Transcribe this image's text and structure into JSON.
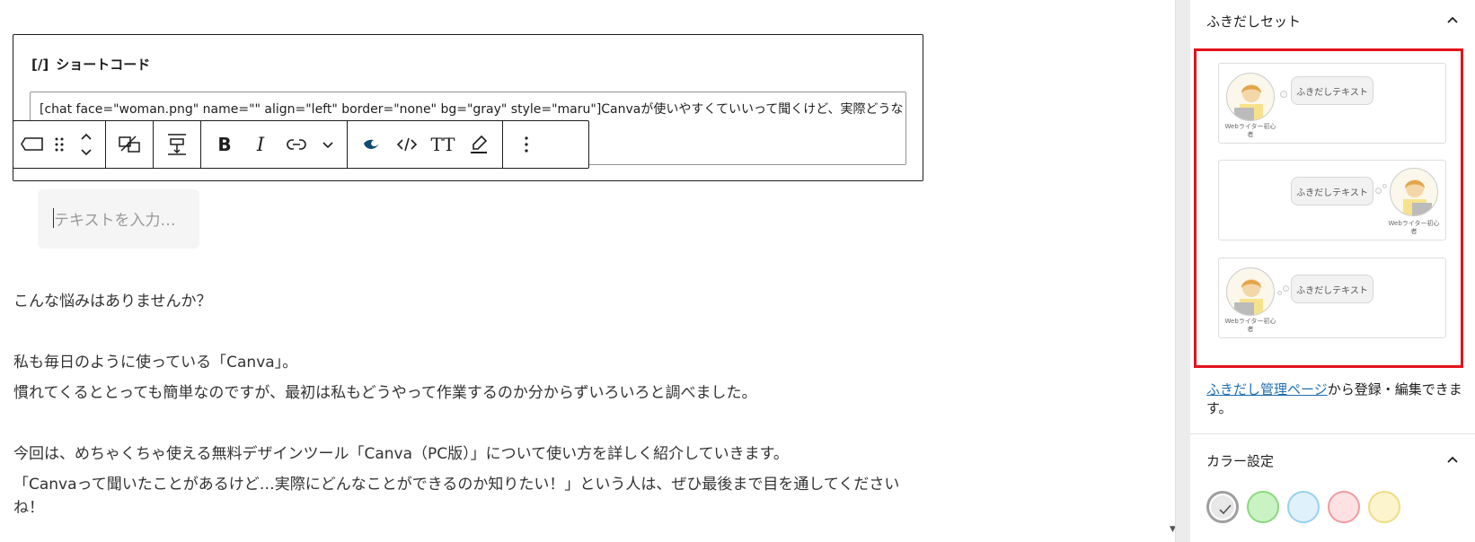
{
  "editor": {
    "shortcode_block": {
      "icon": "[/]",
      "label": "ショートコード",
      "value": "[chat face=\"woman.png\" name=\"\" align=\"left\" border=\"none\" bg=\"gray\" style=\"maru\"]Canvaが使いやすくていいって聞くけど、実際どうな"
    },
    "toolbar": {
      "items": [
        "block-icon",
        "drag-handle-icon",
        "move-up-down-icon",
        "transform-icon",
        "align-icon",
        "bold-icon",
        "italic-icon",
        "link-icon",
        "more-chevron-icon",
        "highlight-icon",
        "code-icon",
        "text-size-icon",
        "marker-icon",
        "options-icon"
      ],
      "bold_label": "B",
      "italic_label": "I",
      "text_size_label": "TT"
    },
    "placeholder": "テキストを入力…",
    "paragraphs": [
      "こんな悩みはありませんか？",
      "私も毎日のように使っている「Canva」。",
      "慣れてくるととっても簡単なのですが、最初は私もどうやって作業するのか分からずいろいろと調べました。",
      "今回は、めちゃくちゃ使える無料デザインツール「Canva（PC版）」について使い方を詳しく紹介していきます。",
      "「Canvaって聞いたことがあるけど…実際にどんなことができるのか知りたい！」という人は、ぜひ最後まで目を通してくださいね！"
    ]
  },
  "sidebar": {
    "fukidashi_panel": {
      "title": "ふきだしセット",
      "cards": [
        {
          "text": "ふきだしテキスト",
          "avatar_name": "Webライター初心者",
          "align": "left",
          "style": "maru"
        },
        {
          "text": "ふきだしテキスト",
          "avatar_name": "Webライター初心者",
          "align": "right",
          "style": "think"
        },
        {
          "text": "ふきだしテキスト",
          "avatar_name": "Webライター初心者",
          "align": "left",
          "style": "think"
        }
      ],
      "link_text": "ふきだし管理ページ",
      "link_suffix": "から登録・編集できます。"
    },
    "color_panel": {
      "title": "カラー設定",
      "swatches": [
        {
          "name": "gray",
          "color": "#e8e8e8",
          "border": "#9e9e9e",
          "selected": true
        },
        {
          "name": "green",
          "color": "#c9f3c2",
          "border": "#88d97b",
          "selected": false
        },
        {
          "name": "blue",
          "color": "#dff1fb",
          "border": "#97d1ee",
          "selected": false
        },
        {
          "name": "red",
          "color": "#fde1e3",
          "border": "#f19aa0",
          "selected": false
        },
        {
          "name": "yellow",
          "color": "#fcf4cc",
          "border": "#efdc86",
          "selected": false
        }
      ]
    }
  }
}
